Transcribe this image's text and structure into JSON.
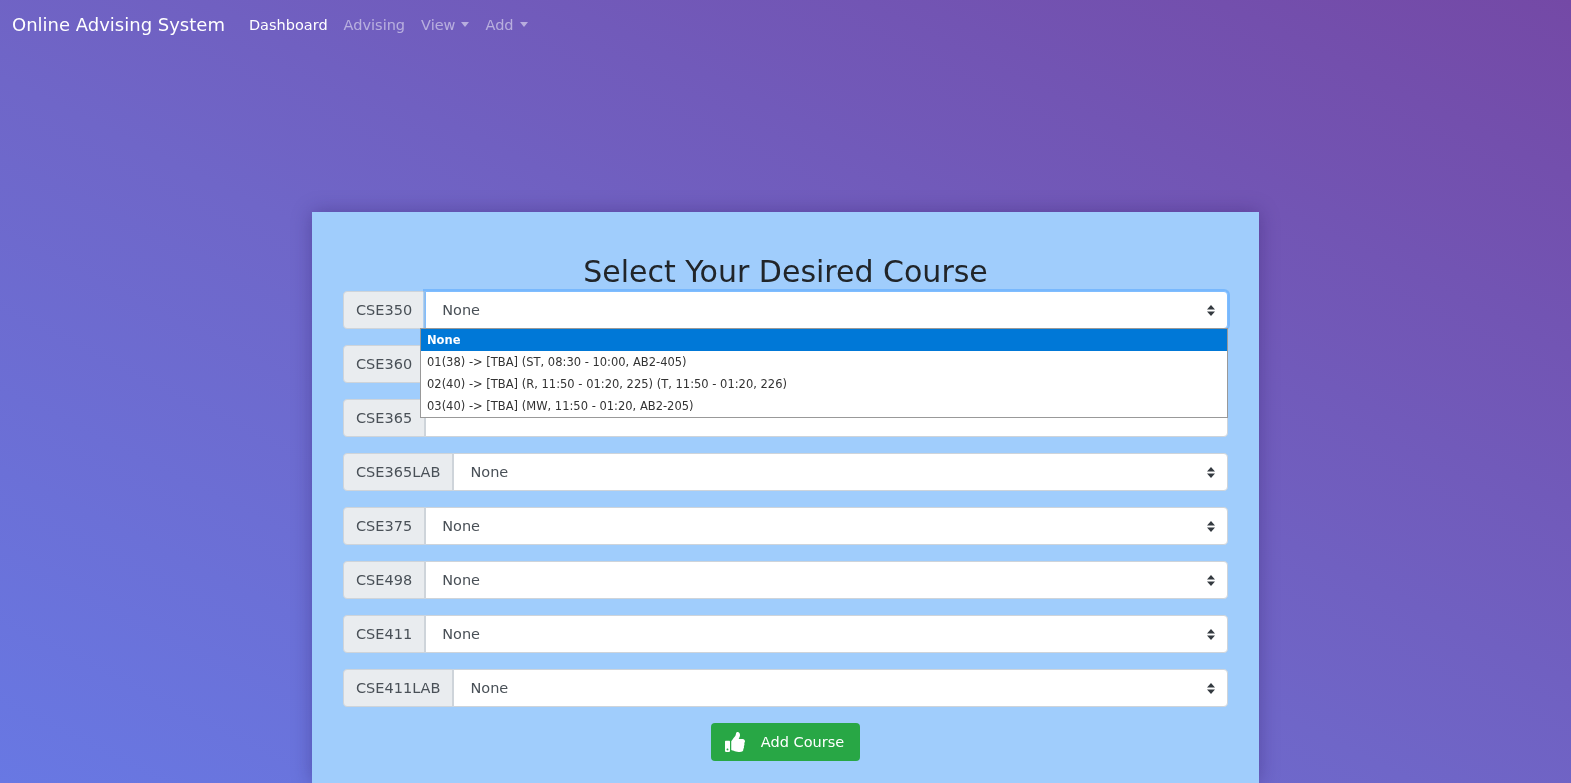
{
  "navbar": {
    "brand": "Online Advising System",
    "links": [
      {
        "label": "Dashboard",
        "selected": true,
        "kind": "link"
      },
      {
        "label": "Advising",
        "selected": false,
        "kind": "link"
      },
      {
        "label": "View",
        "selected": false,
        "kind": "dropdown"
      },
      {
        "label": "Add",
        "selected": false,
        "kind": "dropdown"
      }
    ]
  },
  "card": {
    "title": "Select Your Desired Course",
    "courses": [
      {
        "label": "CSE350",
        "value": "None",
        "open": true,
        "options": [
          {
            "label": "None",
            "selected": true
          },
          {
            "label": "01(38) -> [TBA] (ST, 08:30 - 10:00, AB2-405)",
            "selected": false
          },
          {
            "label": "02(40) -> [TBA] (R, 11:50 - 01:20, 225) (T, 11:50 - 01:20, 226)",
            "selected": false
          },
          {
            "label": "03(40) -> [TBA] (MW, 11:50 - 01:20, AB2-205)",
            "selected": false
          }
        ]
      },
      {
        "label": "CSE360"
      },
      {
        "label": "CSE365",
        "open": false
      },
      {
        "label": "CSE365LAB",
        "value": "None",
        "open": false
      },
      {
        "label": "CSE375",
        "value": "None",
        "open": false
      },
      {
        "label": "CSE498",
        "value": "None",
        "open": false
      },
      {
        "label": "CSE411",
        "value": "None",
        "open": false
      },
      {
        "label": "CSE411LAB",
        "value": "None",
        "open": false
      }
    ],
    "button": "Add Course"
  }
}
